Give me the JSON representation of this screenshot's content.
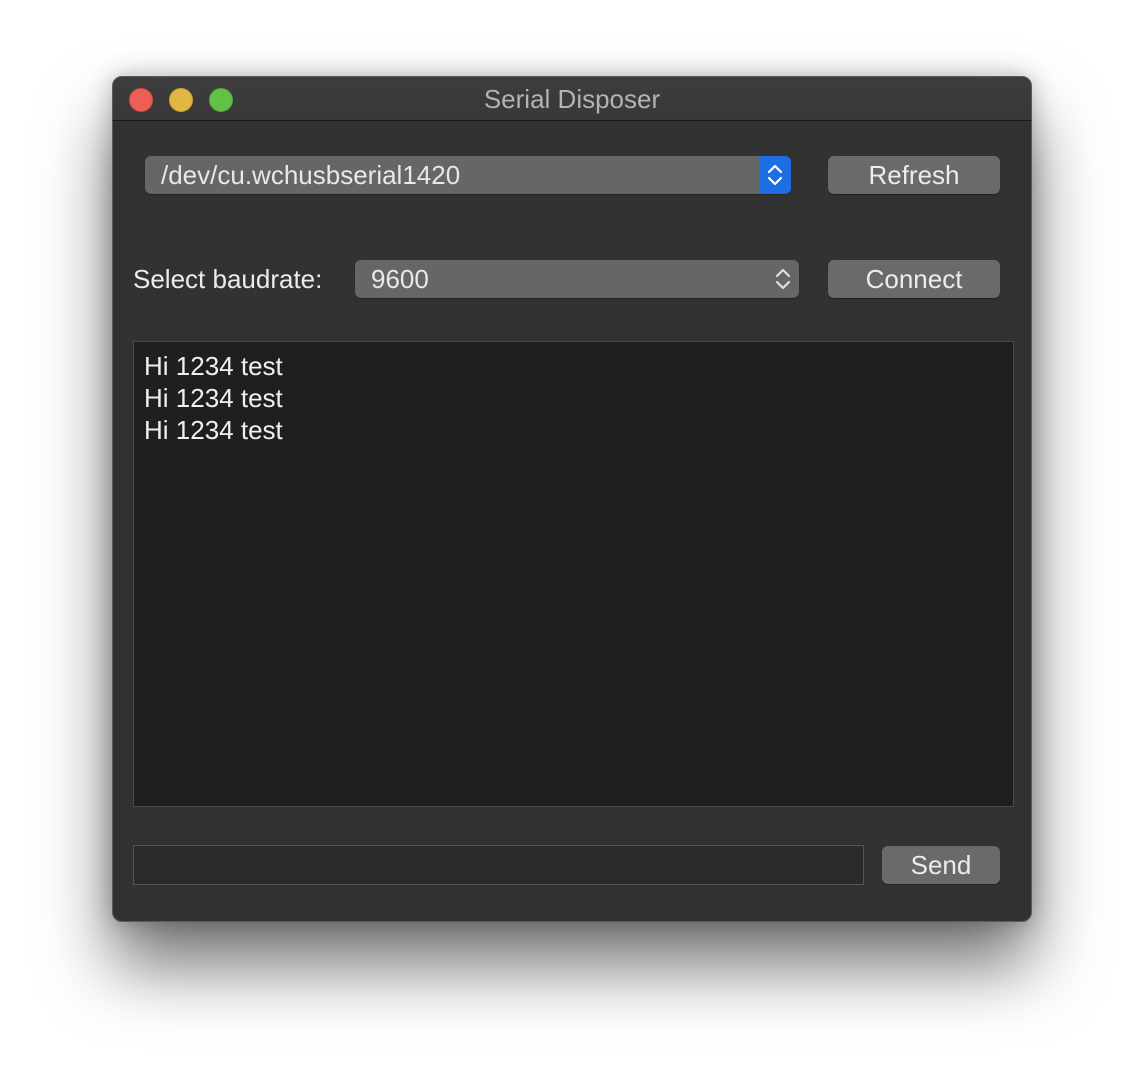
{
  "window": {
    "title": "Serial Disposer"
  },
  "port": {
    "selected": "/dev/cu.wchusbserial1420",
    "refresh_label": "Refresh"
  },
  "baud": {
    "label": "Select baudrate:",
    "selected": "9600",
    "connect_label": "Connect"
  },
  "output": {
    "lines": [
      "Hi 1234 test",
      "Hi 1234 test",
      "Hi 1234 test"
    ]
  },
  "send": {
    "input_value": "",
    "button_label": "Send"
  },
  "colors": {
    "accent": "#1d6ee2",
    "window_bg": "#323232",
    "console_bg": "#1f1f1f",
    "close": "#ec5f57",
    "minimize": "#dfb743",
    "maximize": "#62c146"
  }
}
